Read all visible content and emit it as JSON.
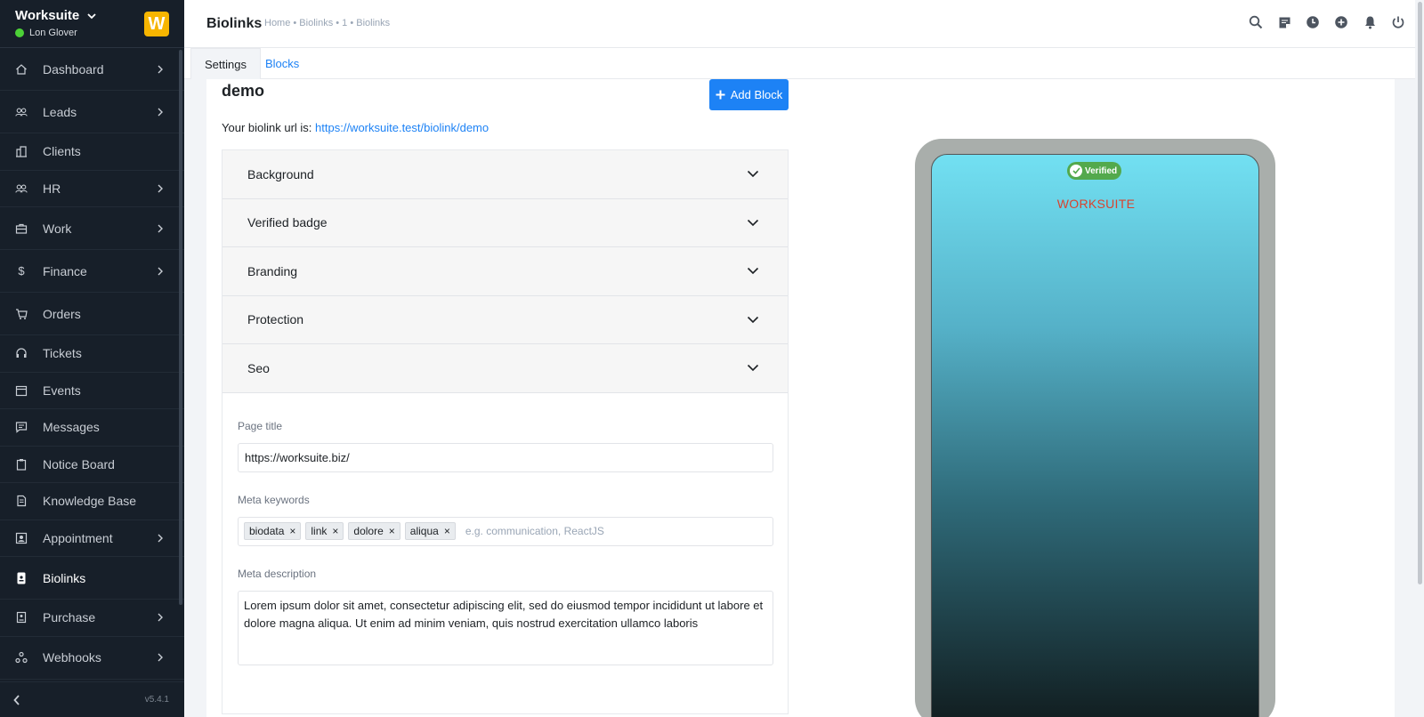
{
  "sidebar": {
    "brand": "Worksuite",
    "logo_letter": "W",
    "user": "Lon Glover",
    "user_status_color": "#4cd137",
    "items": [
      {
        "label": "Dashboard",
        "icon": "home-icon",
        "has_arrow": true
      },
      {
        "label": "Leads",
        "icon": "users-icon",
        "has_arrow": true
      },
      {
        "label": "Clients",
        "icon": "building-icon",
        "has_arrow": false
      },
      {
        "label": "HR",
        "icon": "users-icon",
        "has_arrow": true
      },
      {
        "label": "Work",
        "icon": "briefcase-icon",
        "has_arrow": true
      },
      {
        "label": "Finance",
        "icon": "dollar-icon",
        "has_arrow": true
      },
      {
        "label": "Orders",
        "icon": "cart-icon",
        "has_arrow": false
      },
      {
        "label": "Tickets",
        "icon": "headset-icon",
        "has_arrow": false
      },
      {
        "label": "Events",
        "icon": "calendar-icon",
        "has_arrow": false
      },
      {
        "label": "Messages",
        "icon": "chat-icon",
        "has_arrow": false
      },
      {
        "label": "Notice Board",
        "icon": "clipboard-icon",
        "has_arrow": false
      },
      {
        "label": "Knowledge Base",
        "icon": "document-icon",
        "has_arrow": false
      },
      {
        "label": "Appointment",
        "icon": "contact-icon",
        "has_arrow": true
      },
      {
        "label": "Biolinks",
        "icon": "phone-icon",
        "has_arrow": false,
        "active": true
      },
      {
        "label": "Purchase",
        "icon": "receipt-icon",
        "has_arrow": true
      },
      {
        "label": "Webhooks",
        "icon": "webhook-icon",
        "has_arrow": true
      }
    ],
    "version": "v5.4.1"
  },
  "topbar": {
    "title": "Biolinks",
    "breadcrumb": "Home • Biolinks • 1 • Biolinks",
    "icons": [
      "search-icon",
      "sticky-note-icon",
      "clock-icon",
      "plus-circle-icon",
      "bell-icon",
      "power-icon"
    ]
  },
  "tabs": {
    "settings": "Settings",
    "blocks": "Blocks"
  },
  "main": {
    "name": "demo",
    "add_block_label": "Add Block",
    "url_prefix": "Your biolink url is:",
    "url": "https://worksuite.test/biolink/demo",
    "accordion": [
      "Background",
      "Verified badge",
      "Branding",
      "Protection",
      "Seo"
    ],
    "seo": {
      "page_title_label": "Page title",
      "page_title_value": "https://worksuite.biz/",
      "meta_keywords_label": "Meta keywords",
      "keywords": [
        "biodata",
        "link",
        "dolore",
        "aliqua"
      ],
      "keywords_placeholder": "e.g. communication, ReactJS",
      "meta_description_label": "Meta description",
      "meta_description_value": "Lorem ipsum dolor sit amet, consectetur adipiscing elit, sed do eiusmod tempor incididunt ut labore et dolore magna aliqua. Ut enim ad minim veniam, quis nostrud exercitation ullamco laboris"
    }
  },
  "preview": {
    "badge": "Verified",
    "branding": "WORKSUITE",
    "accent": "#1d82f5"
  }
}
